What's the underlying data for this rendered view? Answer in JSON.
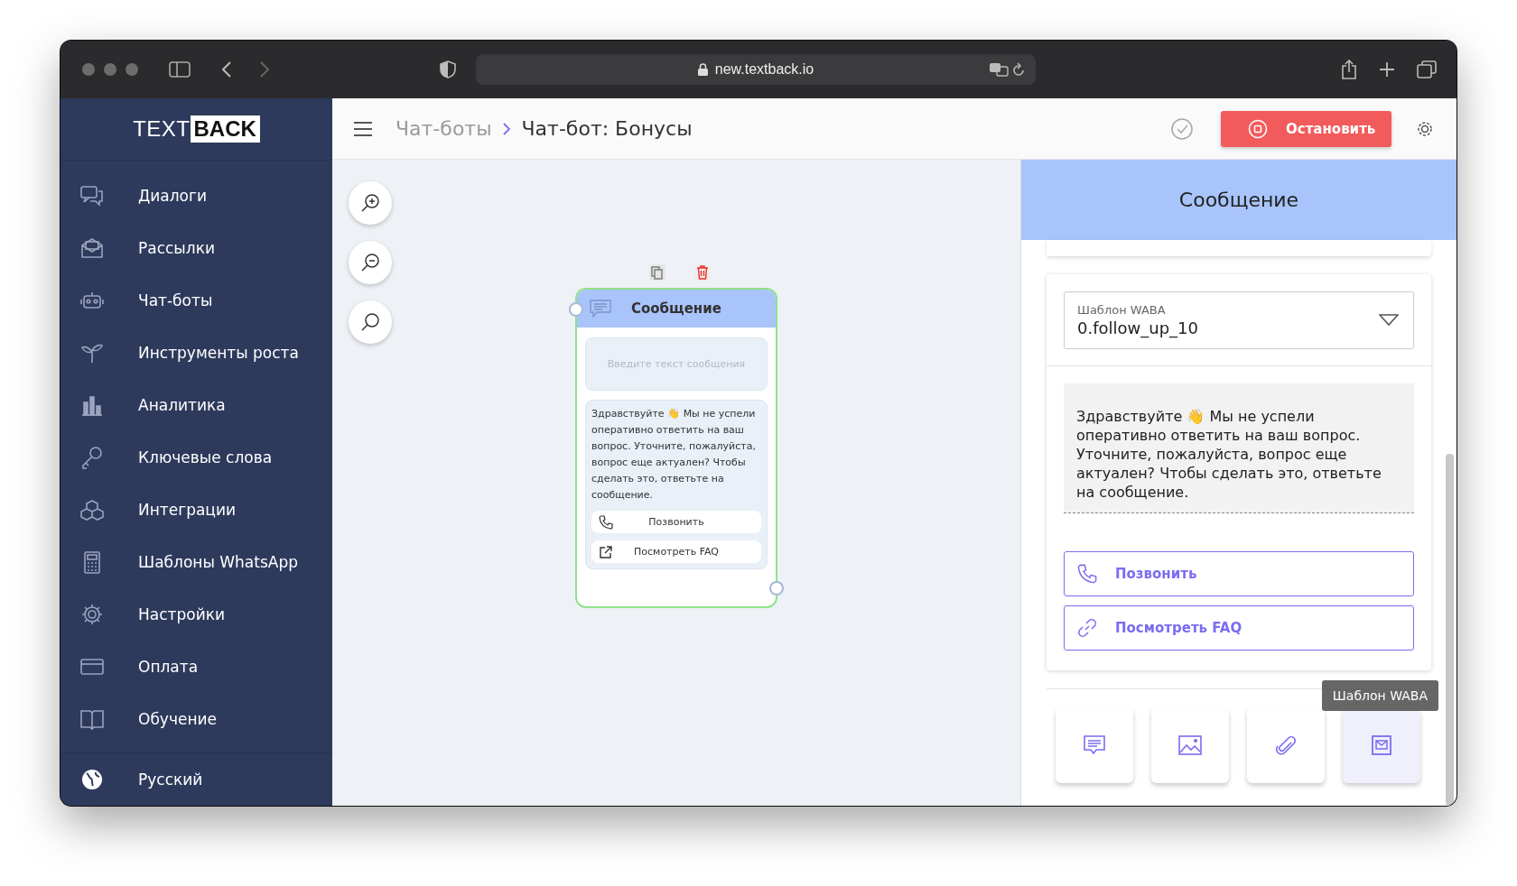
{
  "browser": {
    "url": "new.textback.io"
  },
  "sidebar": {
    "logo": {
      "light": "TEXT",
      "bold": "BACK"
    },
    "items": [
      {
        "label": "Диалоги",
        "selected": false
      },
      {
        "label": "Рассылки",
        "selected": false
      },
      {
        "label": "Чат-боты",
        "selected": false
      },
      {
        "label": "Инструменты роста",
        "selected": false
      },
      {
        "label": "Аналитика",
        "selected": false
      },
      {
        "label": "Ключевые слова",
        "selected": false
      },
      {
        "label": "Интеграции",
        "selected": false
      },
      {
        "label": "Шаблоны WhatsApp",
        "selected": false
      },
      {
        "label": "Настройки",
        "selected": false
      },
      {
        "label": "Оплата",
        "selected": false
      },
      {
        "label": "Обучение",
        "selected": false
      }
    ],
    "language": {
      "label": "Русский"
    }
  },
  "header": {
    "breadcrumb": [
      "Чат-боты",
      "Чат-бот: Бонусы"
    ],
    "stop_button": "Остановить"
  },
  "node": {
    "title": "Сообщение",
    "placeholder": "Введите текст сообщения",
    "text": "Здравствуйте 👋 Мы не успели оперативно ответить на ваш вопрос. Уточните, пожалуйста, вопрос еще актуален? Чтобы сделать это, ответьте на сообщение.",
    "buttons": [
      {
        "label": "Позвонить",
        "kind": "call"
      },
      {
        "label": "Посмотреть FAQ",
        "kind": "link"
      }
    ]
  },
  "panel": {
    "title": "Сообщение",
    "template": {
      "label": "Шаблон WABA",
      "value": "0.follow_up_10"
    },
    "text": "Здравствуйте 👋 Мы не успели оперативно ответить на ваш вопрос. Уточните, пожалуйста, вопрос еще актуален? Чтобы сделать это, ответьте на сообщение.",
    "buttons": [
      {
        "label": "Позвонить",
        "kind": "call"
      },
      {
        "label": "Посмотреть FAQ",
        "kind": "link"
      }
    ],
    "tiles": [
      {
        "kind": "text",
        "selected": false
      },
      {
        "kind": "image",
        "selected": false
      },
      {
        "kind": "file",
        "selected": false
      },
      {
        "kind": "template",
        "selected": true
      }
    ],
    "tooltip": "Шаблон WABA"
  }
}
